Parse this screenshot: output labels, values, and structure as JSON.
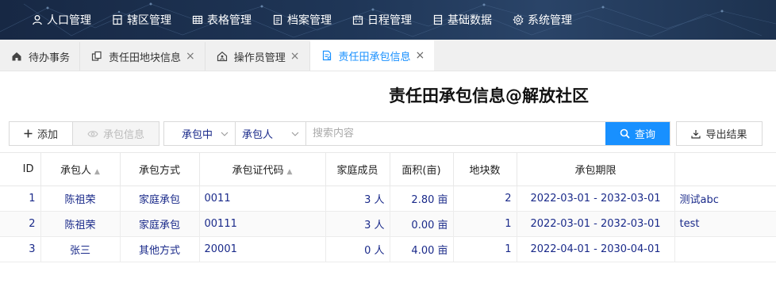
{
  "topnav": {
    "items": [
      {
        "label": "人口管理",
        "icon": "user-icon"
      },
      {
        "label": "辖区管理",
        "icon": "building-icon"
      },
      {
        "label": "表格管理",
        "icon": "table-icon"
      },
      {
        "label": "档案管理",
        "icon": "file-icon"
      },
      {
        "label": "日程管理",
        "icon": "calendar-icon"
      },
      {
        "label": "基础数据",
        "icon": "database-icon"
      },
      {
        "label": "系统管理",
        "icon": "gear-icon"
      }
    ]
  },
  "tabs": [
    {
      "label": "待办事务",
      "icon": "home-icon",
      "closable": false
    },
    {
      "label": "责任田地块信息",
      "icon": "copy-icon",
      "closable": true,
      "close": "×"
    },
    {
      "label": "操作员管理",
      "icon": "house-user-icon",
      "closable": true,
      "close": "×"
    },
    {
      "label": "责任田承包信息",
      "icon": "document-icon",
      "closable": true,
      "close": "×",
      "active": true
    }
  ],
  "page": {
    "title": "责任田承包信息@解放社区"
  },
  "toolbar": {
    "add_label": "添加",
    "info_label": "承包信息",
    "filter_status": "承包中",
    "filter_field": "承包人",
    "search_placeholder": "搜索内容",
    "query_label": "查询",
    "export_label": "导出结果"
  },
  "table": {
    "headers": [
      "ID",
      "承包人",
      "承包方式",
      "承包证代码",
      "家庭成员",
      "面积(亩)",
      "地块数",
      "承包期限",
      ""
    ],
    "rows": [
      {
        "id": "1",
        "contractor": "陈祖荣",
        "method": "家庭承包",
        "code": "0011",
        "members": "3 人",
        "area": "2.80 亩",
        "plots": "2",
        "period": "2022-03-01 - 2032-03-01",
        "note": "测试abc"
      },
      {
        "id": "2",
        "contractor": "陈祖荣",
        "method": "家庭承包",
        "code": "00111",
        "members": "3 人",
        "area": "0.00 亩",
        "plots": "1",
        "period": "2022-03-01 - 2032-03-01",
        "note": "test"
      },
      {
        "id": "3",
        "contractor": "张三",
        "method": "其他方式",
        "code": "20001",
        "members": "0 人",
        "area": "4.00 亩",
        "plots": "1",
        "period": "2022-04-01 - 2030-04-01",
        "note": ""
      }
    ]
  },
  "colors": {
    "accent": "#1890ff",
    "cell_text": "#1a2a8a",
    "nav_bg": "#1f3657"
  }
}
